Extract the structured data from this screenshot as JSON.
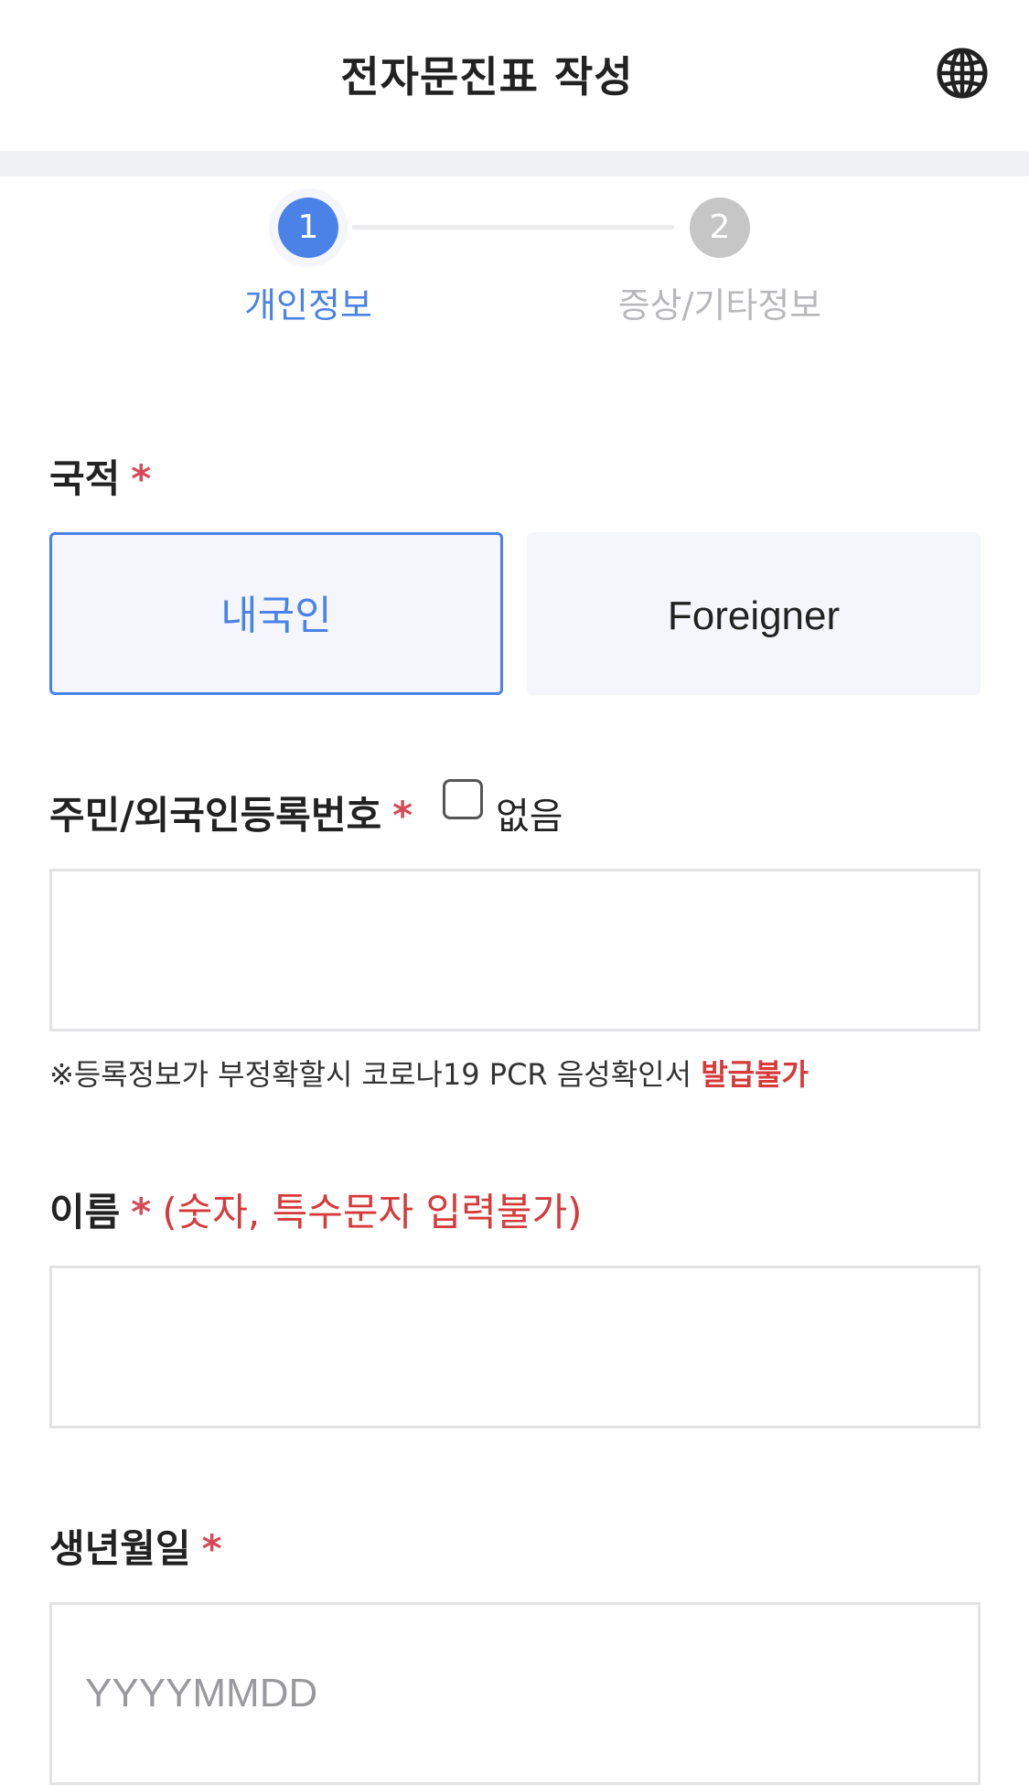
{
  "header": {
    "title": "전자문진표 작성"
  },
  "stepper": {
    "steps": [
      {
        "number": "1",
        "label": "개인정보",
        "state": "active"
      },
      {
        "number": "2",
        "label": "증상/기타정보",
        "state": "inactive"
      }
    ]
  },
  "nationality": {
    "label": "국적",
    "required_mark": "*",
    "options": [
      "내국인",
      "Foreigner"
    ],
    "selected": "내국인"
  },
  "id_number": {
    "label": "주민/외국인등록번호",
    "required_mark": "*",
    "none_checkbox_label": "없음",
    "value": "",
    "hint_prefix": "※등록정보가 부정확할시 코로나19 PCR 음성확인서 ",
    "hint_emphasis": "발급불가"
  },
  "name": {
    "label": "이름",
    "required_mark": "*",
    "note": "(숫자, 특수문자 입력불가)",
    "value": ""
  },
  "birthdate": {
    "label": "생년월일",
    "required_mark": "*",
    "placeholder": "YYYYMMDD",
    "value": ""
  },
  "colors": {
    "accent": "#4a82e8",
    "required": "#d64a57",
    "warning": "#d63a3a",
    "inactive": "#c6c6c6"
  },
  "icons": {
    "language": "globe-icon"
  }
}
